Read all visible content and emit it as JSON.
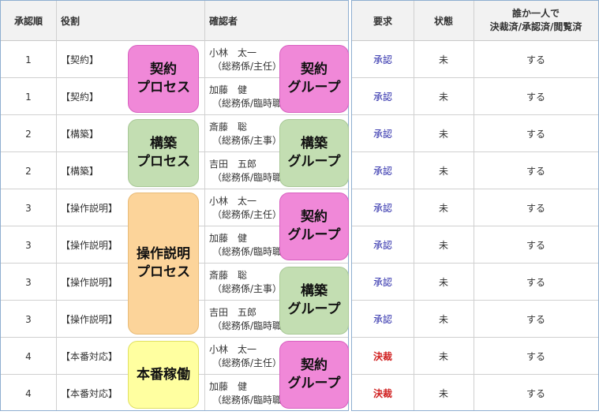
{
  "headers": {
    "order": "承認順",
    "role": "役割",
    "confirmer": "確認者",
    "request": "要求",
    "status": "状態",
    "anyone_line1": "誰か一人で",
    "anyone_line2": "決裁済/承認済/閲覧済"
  },
  "rows": [
    {
      "order": "1",
      "role": "【契約】",
      "name": "小林　太一",
      "dept": "（総務係/主任）",
      "request": "承認",
      "request_type": "approve",
      "status": "未",
      "anyone": "する"
    },
    {
      "order": "1",
      "role": "【契約】",
      "name": "加藤　健",
      "dept": "（総務係/臨時職員）",
      "request": "承認",
      "request_type": "approve",
      "status": "未",
      "anyone": "する"
    },
    {
      "order": "2",
      "role": "【構築】",
      "name": "斎藤　聡",
      "dept": "（総務係/主事）",
      "request": "承認",
      "request_type": "approve",
      "status": "未",
      "anyone": "する"
    },
    {
      "order": "2",
      "role": "【構築】",
      "name": "吉田　五郎",
      "dept": "（総務係/臨時職員）",
      "request": "承認",
      "request_type": "approve",
      "status": "未",
      "anyone": "する"
    },
    {
      "order": "3",
      "role": "【操作説明】",
      "name": "小林　太一",
      "dept": "（総務係/主任）",
      "request": "承認",
      "request_type": "approve",
      "status": "未",
      "anyone": "する"
    },
    {
      "order": "3",
      "role": "【操作説明】",
      "name": "加藤　健",
      "dept": "（総務係/臨時職員）",
      "request": "承認",
      "request_type": "approve",
      "status": "未",
      "anyone": "する"
    },
    {
      "order": "3",
      "role": "【操作説明】",
      "name": "斎藤　聡",
      "dept": "（総務係/主事）",
      "request": "承認",
      "request_type": "approve",
      "status": "未",
      "anyone": "する"
    },
    {
      "order": "3",
      "role": "【操作説明】",
      "name": "吉田　五郎",
      "dept": "（総務係/臨時職員）",
      "request": "承認",
      "request_type": "approve",
      "status": "未",
      "anyone": "する"
    },
    {
      "order": "4",
      "role": "【本番対応】",
      "name": "小林　太一",
      "dept": "（総務係/主任）",
      "request": "決裁",
      "request_type": "decide",
      "status": "未",
      "anyone": "する"
    },
    {
      "order": "4",
      "role": "【本番対応】",
      "name": "加藤　健",
      "dept": "（総務係/臨時職員）",
      "request": "決裁",
      "request_type": "decide",
      "status": "未",
      "anyone": "する"
    }
  ],
  "process_labels": [
    {
      "line1": "契約",
      "line2": "プロセス",
      "color": "pink"
    },
    {
      "line1": "構築",
      "line2": "プロセス",
      "color": "green"
    },
    {
      "line1": "操作説明",
      "line2": "プロセス",
      "color": "orange"
    },
    {
      "line1": "本番稼働",
      "line2": "",
      "color": "yellow"
    }
  ],
  "group_labels": [
    {
      "line1": "契約",
      "line2": "グループ",
      "color": "pink"
    },
    {
      "line1": "構築",
      "line2": "グループ",
      "color": "green"
    },
    {
      "line1": "契約",
      "line2": "グループ",
      "color": "pink"
    },
    {
      "line1": "構築",
      "line2": "グループ",
      "color": "green"
    },
    {
      "line1": "契約",
      "line2": "グループ",
      "color": "pink"
    }
  ],
  "colors": {
    "pink": "#f088d8",
    "green": "#c3deb2",
    "orange": "#fcd49a",
    "yellow": "#ffffa0",
    "approve_text": "#2828a8",
    "decide_text": "#d02020",
    "header_bg": "#f2f2f2",
    "panel_border": "#8eaed0"
  }
}
